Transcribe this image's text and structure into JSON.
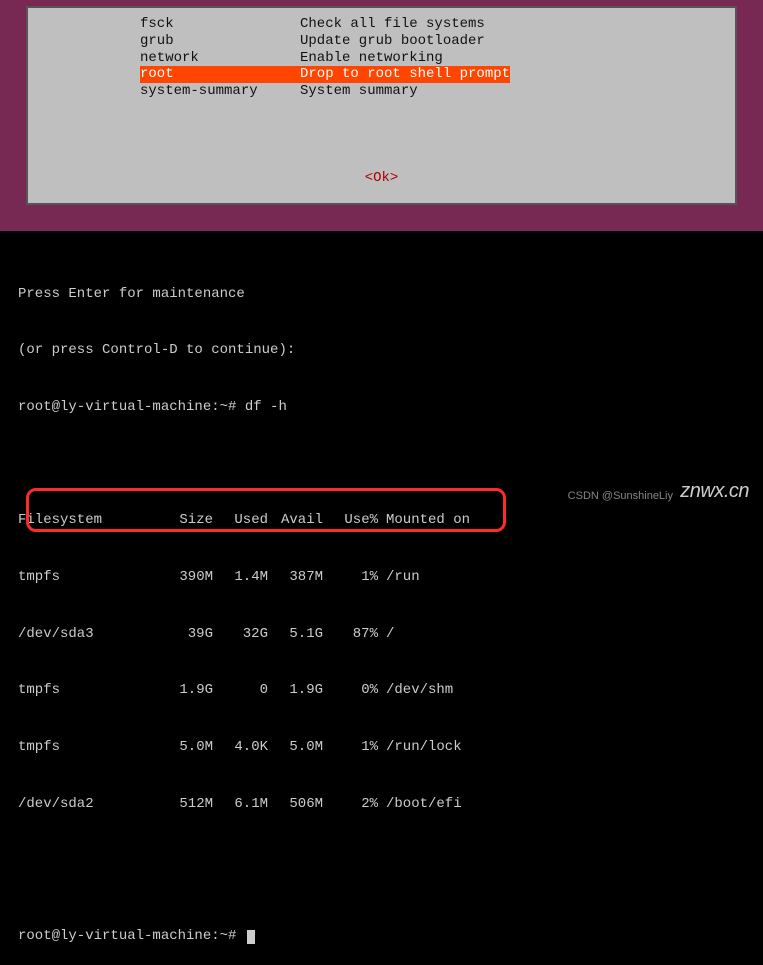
{
  "dialog": {
    "menu": [
      {
        "key": "fsck",
        "desc": "Check all file systems",
        "hl": false
      },
      {
        "key": "grub",
        "desc": "Update grub bootloader",
        "hl": false
      },
      {
        "key": "network",
        "desc": "Enable networking",
        "hl": false
      },
      {
        "key": "root",
        "desc": "Drop to root shell prompt",
        "hl": true
      },
      {
        "key": "system-summary",
        "desc": "System summary",
        "hl": false
      }
    ],
    "ok": "<Ok>"
  },
  "terminal": {
    "maint1": "Press Enter for maintenance",
    "maint2": "(or press Control-D to continue):",
    "prompt1": "root@ly-virtual-machine:~# ",
    "cmd1": "df -h",
    "df_headers": {
      "fs": "Filesystem",
      "size": "Size",
      "used": "Used",
      "avail": "Avail",
      "usep": "Use%",
      "mount": "Mounted on"
    },
    "df_rows": [
      {
        "fs": "tmpfs",
        "size": "390M",
        "used": "1.4M",
        "avail": "387M",
        "usep": "1%",
        "mount": "/run"
      },
      {
        "fs": "/dev/sda3",
        "size": "39G",
        "used": "32G",
        "avail": "5.1G",
        "usep": "87%",
        "mount": "/"
      },
      {
        "fs": "tmpfs",
        "size": "1.9G",
        "used": "0",
        "avail": "1.9G",
        "usep": "0%",
        "mount": "/dev/shm"
      },
      {
        "fs": "tmpfs",
        "size": "5.0M",
        "used": "4.0K",
        "avail": "5.0M",
        "usep": "1%",
        "mount": "/run/lock"
      },
      {
        "fs": "/dev/sda2",
        "size": "512M",
        "used": "6.1M",
        "avail": "506M",
        "usep": "2%",
        "mount": "/boot/efi"
      }
    ],
    "prompt2": "root@ly-virtual-machine:~# "
  },
  "watermarks": {
    "csdn": "CSDN @SunshineLiy",
    "znwx": "znwx.cn"
  }
}
